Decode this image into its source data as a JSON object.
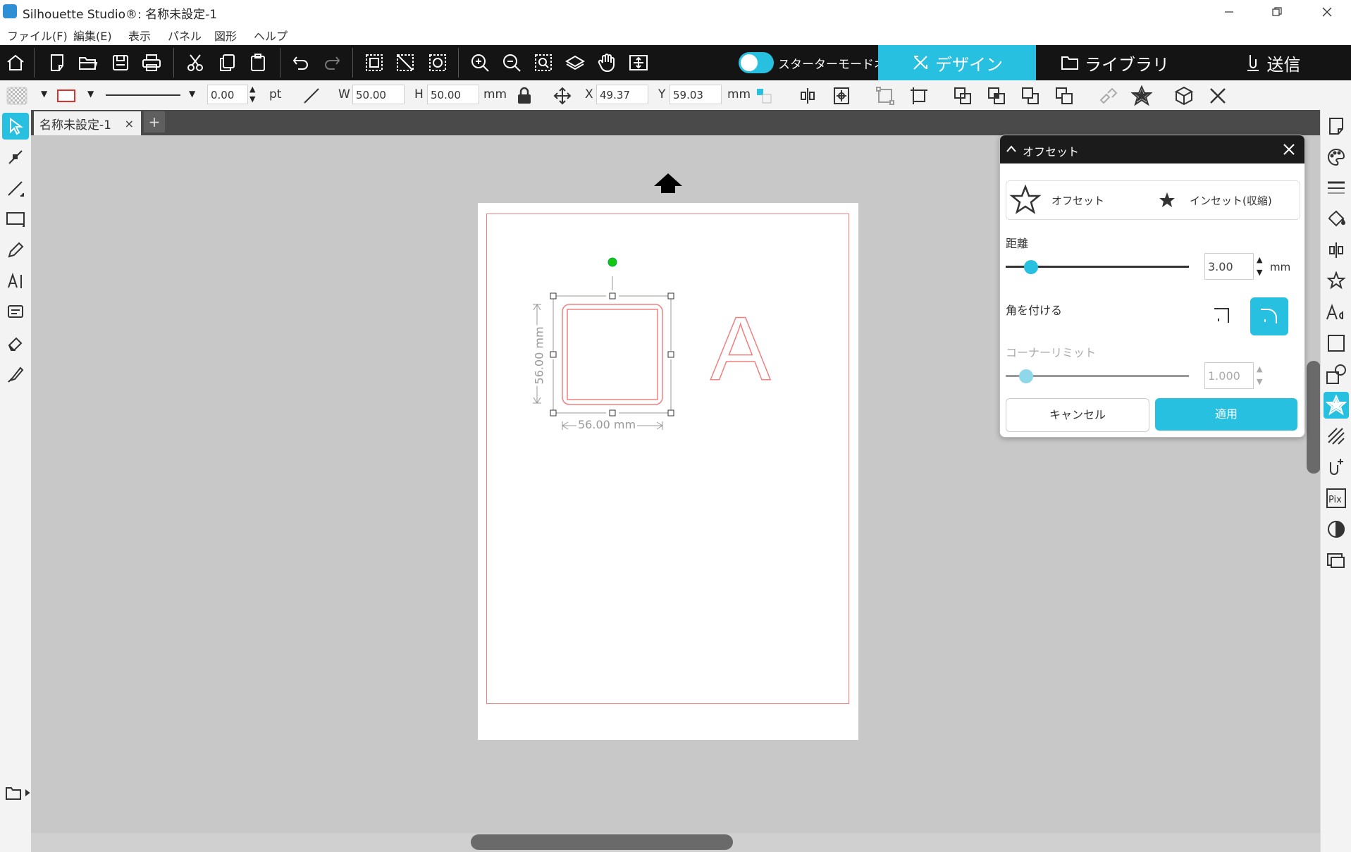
{
  "window": {
    "title": "Silhouette Studio®: 名称未設定-1"
  },
  "menu": [
    "ファイル(F)",
    "編集(E)",
    "表示",
    "パネル",
    "図形",
    "ヘルプ"
  ],
  "toolbar": {
    "starter_mode_label": "スターターモードオフ",
    "tabs": {
      "design": "デザイン",
      "library": "ライブラリ",
      "send": "送信"
    }
  },
  "properties": {
    "line_width": "0.00",
    "line_unit": "pt",
    "w_label": "W",
    "w_value": "50.00",
    "h_label": "H",
    "h_value": "50.00",
    "size_unit": "mm",
    "x_label": "X",
    "x_value": "49.37",
    "y_label": "Y",
    "y_value": "59.03",
    "pos_unit": "mm"
  },
  "document_tab": {
    "name": "名称未設定-1",
    "close": "×",
    "add": "+"
  },
  "canvas": {
    "dim_height": "56.00 mm",
    "dim_width": "56.00 mm",
    "letter": "A"
  },
  "offset_panel": {
    "title": "オフセット",
    "mode_offset": "オフセット",
    "mode_inset": "インセット(収縮)",
    "distance_label": "距離",
    "distance_value": "3.00",
    "distance_unit": "mm",
    "distance_slider_fraction": 0.14,
    "corner_label": "角を付ける",
    "corner_limit_label": "コーナーリミット",
    "corner_limit_value": "1.000",
    "corner_limit_fraction": 0.11,
    "cancel": "キャンセル",
    "apply": "適用"
  },
  "colors": {
    "accent": "#27c0e0",
    "cut_line": "#f08080",
    "toolbar_bg": "#141414"
  }
}
